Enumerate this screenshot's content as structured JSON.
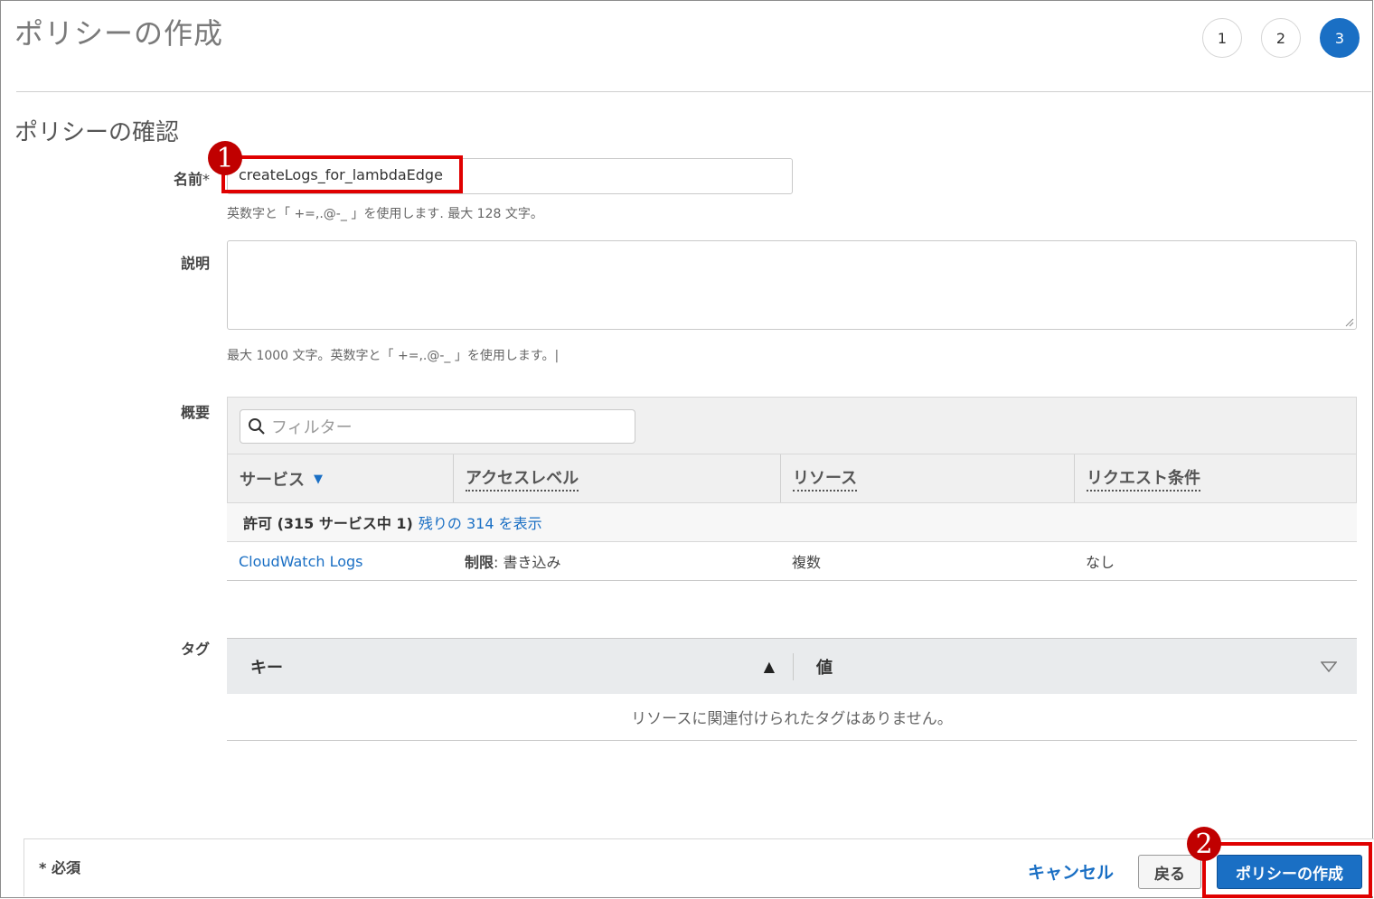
{
  "page": {
    "title": "ポリシーの作成"
  },
  "steps": [
    {
      "label": "1",
      "active": false
    },
    {
      "label": "2",
      "active": false
    },
    {
      "label": "3",
      "active": true
    }
  ],
  "section": {
    "title": "ポリシーの確認"
  },
  "name_field": {
    "label": "名前",
    "required_mark": "*",
    "value": "createLogs_for_lambdaEdge",
    "hint": "英数字と「 +=,.@-_ 」を使用します. 最大 128 文字。"
  },
  "description_field": {
    "label": "説明",
    "value": "",
    "hint": "最大 1000 文字。英数字と「 +=,.@-_ 」を使用します。|"
  },
  "summary": {
    "label": "概要",
    "filter_placeholder": "フィルター",
    "columns": [
      "サービス",
      "アクセスレベル",
      "リソース",
      "リクエスト条件"
    ],
    "group": {
      "label": "許可 (315 サービス中 1)",
      "link": "残りの 314 を表示"
    },
    "rows": [
      {
        "service": "CloudWatch Logs",
        "access_level_bold": "制限",
        "access_level_rest": ": 書き込み",
        "resource": "複数",
        "condition": "なし"
      }
    ]
  },
  "tags": {
    "label": "タグ",
    "key_header": "キー",
    "value_header": "値",
    "empty_message": "リソースに関連付けられたタグはありません。"
  },
  "footer": {
    "required_note": "* 必須",
    "cancel_label": "キャンセル",
    "back_label": "戻る",
    "create_label": "ポリシーの作成"
  },
  "annotations": [
    {
      "number": "1"
    },
    {
      "number": "2"
    }
  ],
  "colors": {
    "accent": "#1a6fc4",
    "highlight": "#e00000",
    "badge": "#c00000"
  }
}
